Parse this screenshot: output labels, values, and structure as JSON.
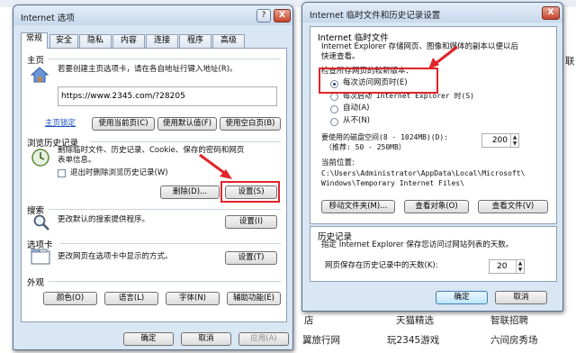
{
  "background_page": {
    "links": [
      "天猫精选",
      "智联招聘",
      "翼旅行网",
      "玩2345游戏",
      "六间房秀场"
    ],
    "fragments": [
      "店",
      "联"
    ]
  },
  "internet_options": {
    "title": "Internet 选项",
    "help_btn": "?",
    "close_btn": "X",
    "tabs": [
      "常规",
      "安全",
      "隐私",
      "内容",
      "连接",
      "程序",
      "高级"
    ],
    "homepage": {
      "header": "主页",
      "desc": "若要创建主页选项卡，请在各自地址行键入地址(R)。",
      "url": "https://www.2345.com/?28205",
      "link_label": "主页锁定",
      "btn_current": "使用当前页(C)",
      "btn_default": "使用默认值(F)",
      "btn_blank": "使用空白页(B)"
    },
    "history": {
      "header": "浏览历史记录",
      "desc_line1": "删除临时文件、历史记录、Cookie、保存的密码和网页",
      "desc_line2": "表单信息。",
      "checkbox_label": "退出时删除浏览历史记录(W)",
      "btn_delete": "删除(D)...",
      "btn_settings": "设置(S)"
    },
    "search": {
      "header": "搜索",
      "desc": "更改默认的搜索提供程序。",
      "btn": "设置(I)"
    },
    "tabs_section": {
      "header": "选项卡",
      "desc": "更改网页在选项卡中显示的方式。",
      "btn": "设置(T)"
    },
    "appearance": {
      "header": "外观",
      "btn_colors": "颜色(O)",
      "btn_languages": "语言(L)",
      "btn_fonts": "字体(N)",
      "btn_accessibility": "辅助功能(E)"
    },
    "footer": {
      "ok": "确定",
      "cancel": "取消",
      "apply": "应用(A)"
    }
  },
  "temp_files_dialog": {
    "title": "Internet 临时文件和历史记录设置",
    "close_btn": "X",
    "group_temp": "Internet 临时文件",
    "desc_line1": "Internet Explorer 存储网页、图像和媒体的副本以便以后",
    "desc_line2": "快速查看。",
    "check_label": "检查所存网页的较新版本：",
    "options": [
      {
        "label": "每次访问网页时(E)",
        "selected": true
      },
      {
        "label": "每次启动 Internet Explorer 时(S)",
        "selected": false
      },
      {
        "label": "自动(A)",
        "selected": false
      },
      {
        "label": "从不(N)",
        "selected": false
      }
    ],
    "disk_label_line1": "要使用的磁盘空间(8 - 1024MB)(D):",
    "disk_label_line2": "（推荐: 50 - 250MB）",
    "disk_value": "200",
    "location_label": "当前位置:",
    "location_line1": "C:\\Users\\Administrator\\AppData\\Local\\Microsoft\\",
    "location_line2": "Windows\\Temporary Internet Files\\",
    "btn_move": "移动文件夹(M)...",
    "btn_objects": "查看对象(O)",
    "btn_files": "查看文件(V)",
    "group_history": "历史记录",
    "history_desc": "指定 Internet Explorer 保存您访问过网站列表的天数。",
    "days_label": "网页保存在历史记录中的天数(K):",
    "days_value": "20",
    "ok": "确定",
    "cancel": "取消"
  },
  "colors": {
    "highlight": "#e0242a",
    "link": "#1a4fc4",
    "window_frame": "#d9e6f3"
  }
}
